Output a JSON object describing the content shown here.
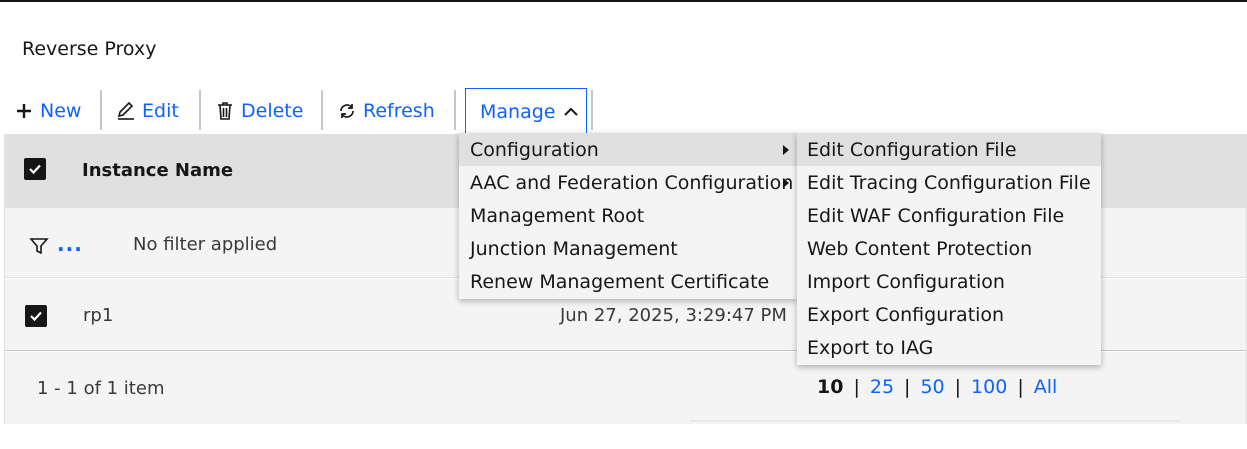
{
  "page": {
    "title": "Reverse Proxy"
  },
  "toolbar": {
    "new_label": "New",
    "edit_label": "Edit",
    "delete_label": "Delete",
    "refresh_label": "Refresh",
    "manage_label": "Manage"
  },
  "table": {
    "header": {
      "instance_name": "Instance Name",
      "select_all_checked": true
    },
    "filter": {
      "more_label": "...",
      "status": "No filter applied"
    },
    "rows": [
      {
        "name": "rp1",
        "date": "Jun 27, 2025, 3:29:47 PM",
        "checked": true
      }
    ],
    "pagination": {
      "count_label": "1 - 1 of 1 item",
      "sizes": [
        "10",
        "25",
        "50",
        "100",
        "All"
      ],
      "active_size": "10"
    }
  },
  "manage_menu": {
    "items": [
      {
        "label": "Configuration",
        "submenu": true,
        "highlighted": true
      },
      {
        "label": "AAC and Federation Configuration",
        "submenu": true
      },
      {
        "label": "Management Root"
      },
      {
        "label": "Junction Management"
      },
      {
        "label": "Renew Management Certificate"
      }
    ]
  },
  "configuration_submenu": {
    "items": [
      {
        "label": "Edit Configuration File",
        "highlighted": true
      },
      {
        "label": "Edit Tracing Configuration File"
      },
      {
        "label": "Edit WAF Configuration File"
      },
      {
        "label": "Web Content Protection"
      },
      {
        "label": "Import Configuration"
      },
      {
        "label": "Export Configuration"
      },
      {
        "label": "Export to IAG"
      }
    ]
  },
  "colors": {
    "link": "#0f62fe",
    "header_bg": "#e0e0e0",
    "row_bg": "#f4f4f4",
    "text": "#161616"
  },
  "icons": [
    "plus-icon",
    "edit-icon",
    "trash-icon",
    "refresh-icon",
    "chevron-up-icon",
    "filter-icon",
    "checkmark-icon",
    "caret-right-icon"
  ]
}
